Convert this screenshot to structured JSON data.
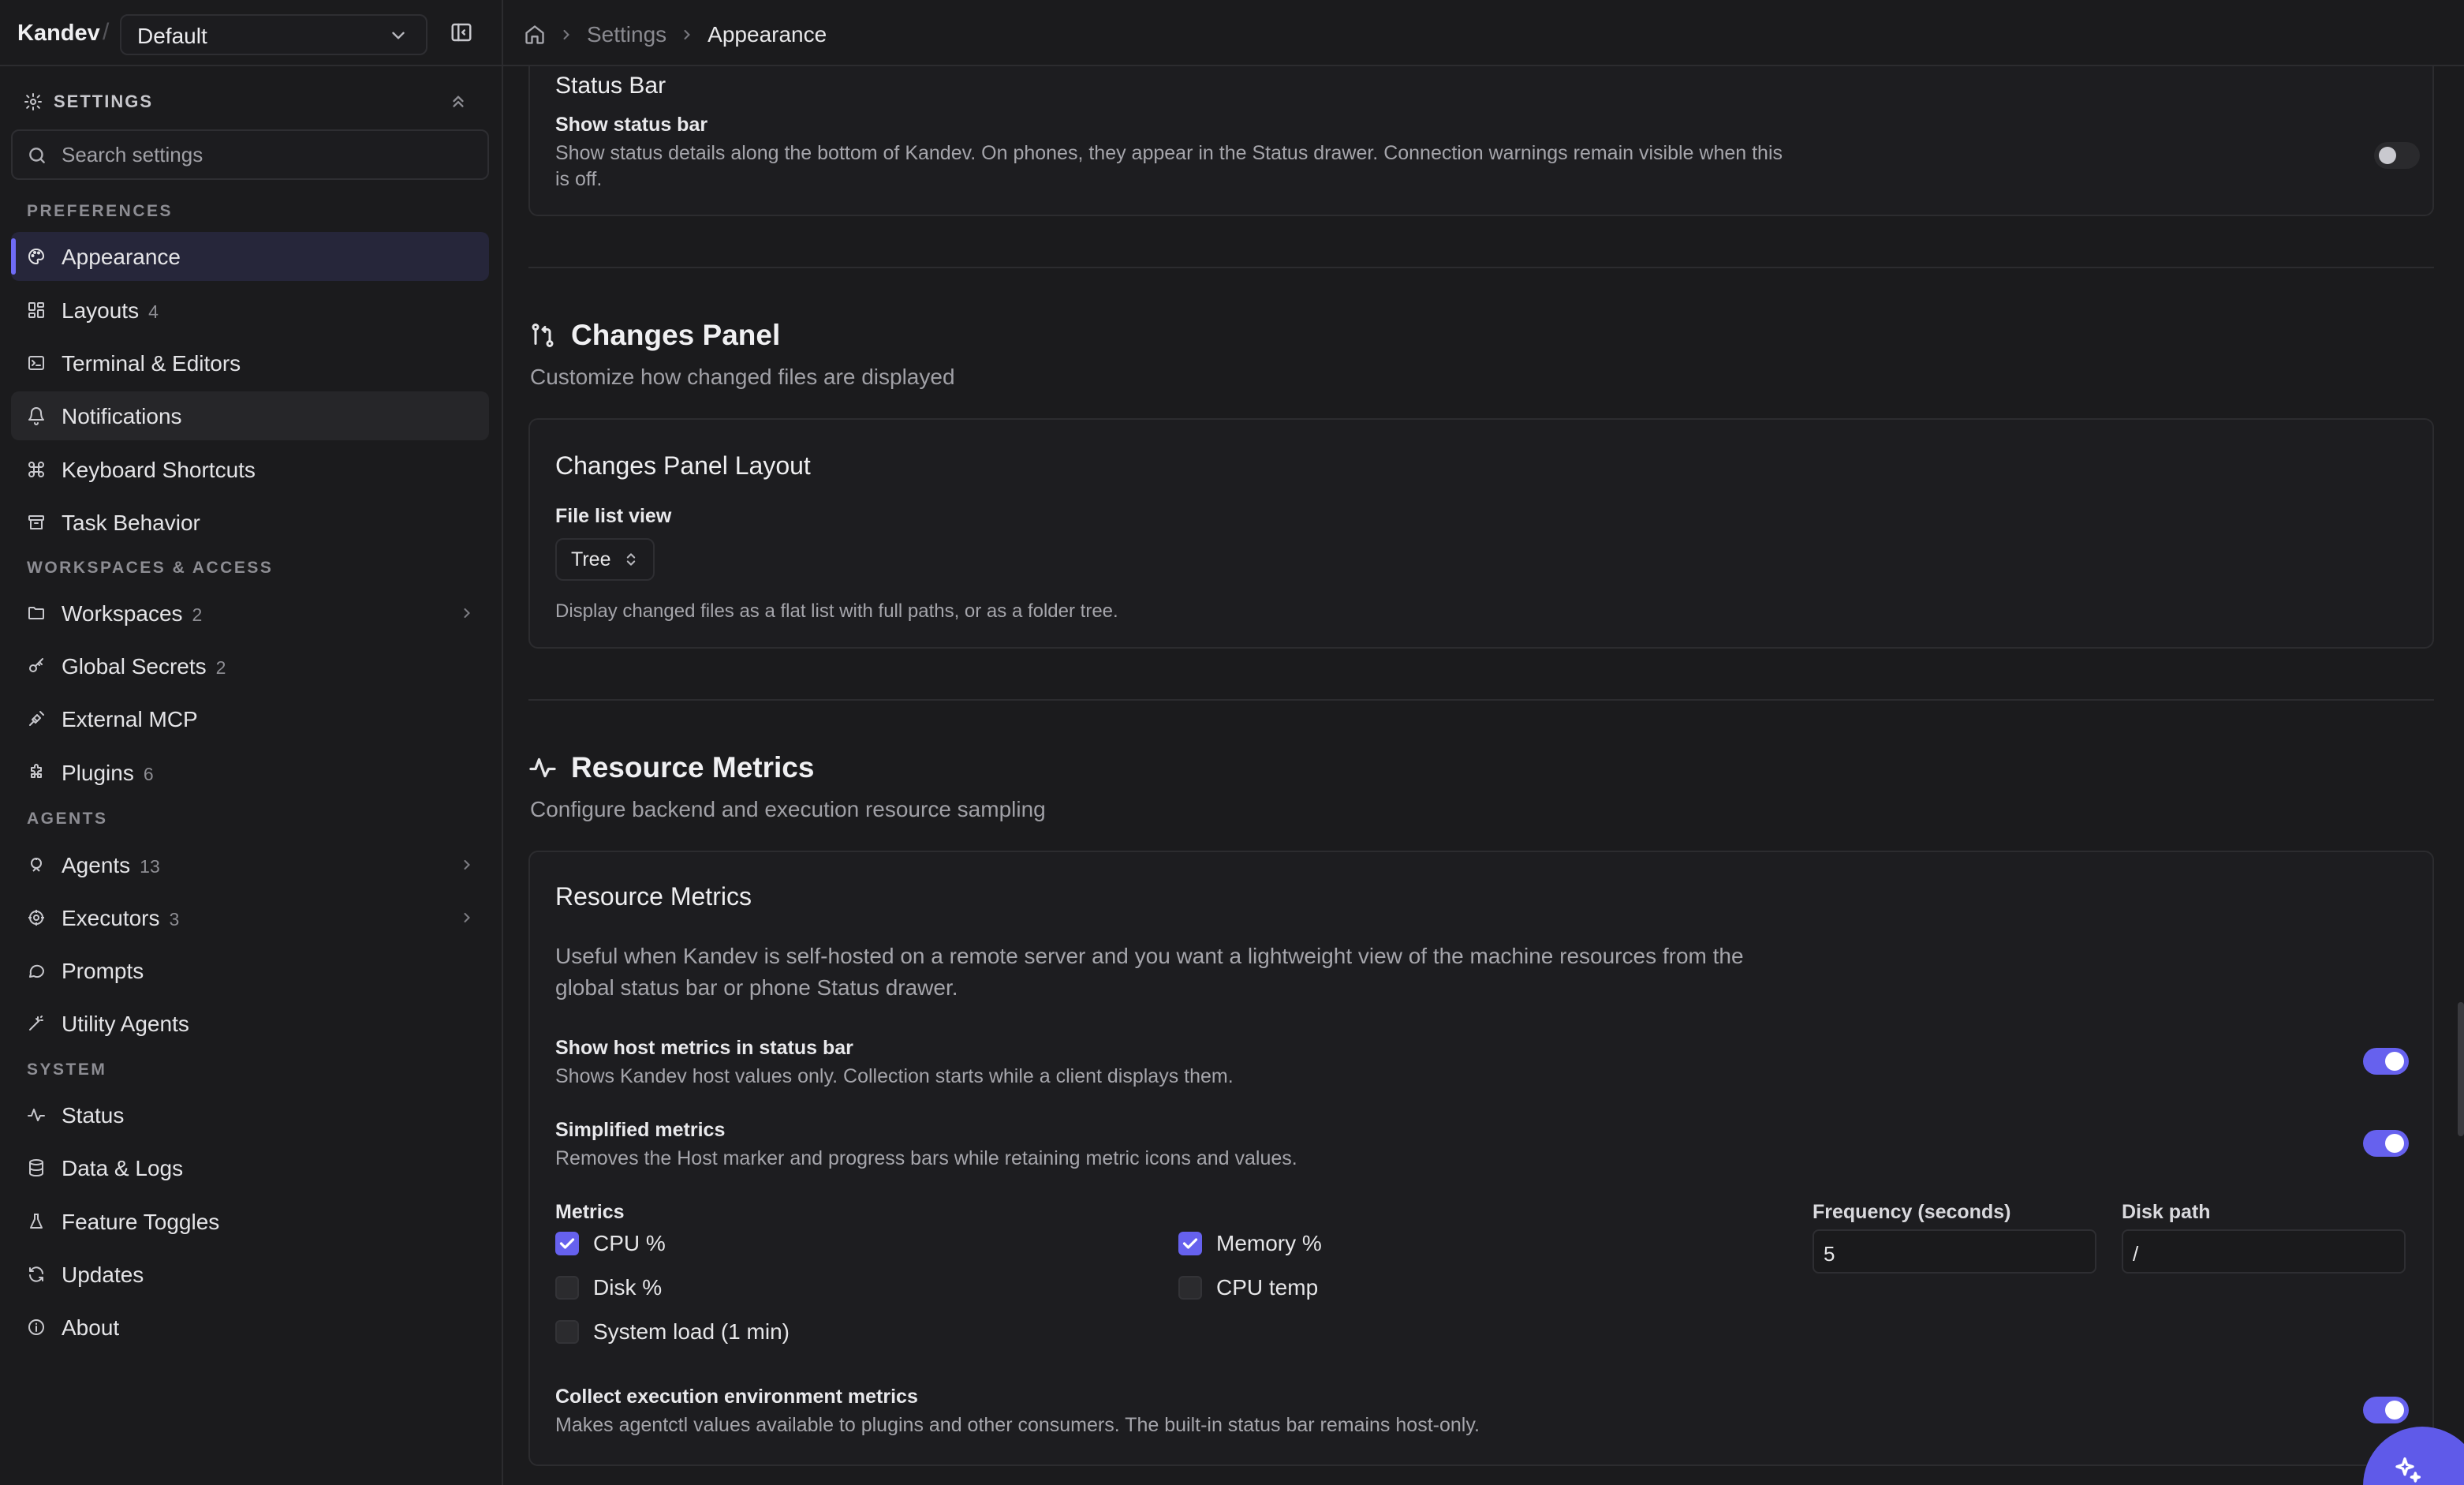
{
  "topbar": {
    "brand": "Kandev",
    "separator": "/",
    "workspace": "Default",
    "breadcrumb": {
      "settings": "Settings",
      "current": "Appearance"
    }
  },
  "sidebar": {
    "header": "SETTINGS",
    "search_placeholder": "Search settings",
    "groups": [
      {
        "label": "PREFERENCES"
      },
      {
        "label": "WORKSPACES & ACCESS"
      },
      {
        "label": "AGENTS"
      },
      {
        "label": "SYSTEM"
      }
    ],
    "items": [
      {
        "label": "Appearance",
        "count": ""
      },
      {
        "label": "Layouts",
        "count": "4"
      },
      {
        "label": "Terminal & Editors",
        "count": ""
      },
      {
        "label": "Notifications",
        "count": ""
      },
      {
        "label": "Keyboard Shortcuts",
        "count": ""
      },
      {
        "label": "Task Behavior",
        "count": ""
      },
      {
        "label": "Workspaces",
        "count": "2"
      },
      {
        "label": "Global Secrets",
        "count": "2"
      },
      {
        "label": "External MCP",
        "count": ""
      },
      {
        "label": "Plugins",
        "count": "6"
      },
      {
        "label": "Agents",
        "count": "13"
      },
      {
        "label": "Executors",
        "count": "3"
      },
      {
        "label": "Prompts",
        "count": ""
      },
      {
        "label": "Utility Agents",
        "count": ""
      },
      {
        "label": "Status",
        "count": ""
      },
      {
        "label": "Data & Logs",
        "count": ""
      },
      {
        "label": "Feature Toggles",
        "count": ""
      },
      {
        "label": "Updates",
        "count": ""
      },
      {
        "label": "About",
        "count": ""
      }
    ]
  },
  "status_bar": {
    "card_title": "Status Bar",
    "row_title": "Show status bar",
    "row_desc": "Show status details along the bottom of Kandev. On phones, they appear in the Status drawer. Connection warnings remain visible when this is off.",
    "enabled": false
  },
  "changes_panel": {
    "title": "Changes Panel",
    "subtitle": "Customize how changed files are displayed",
    "card_title": "Changes Panel Layout",
    "field_label": "File list view",
    "value": "Tree",
    "help": "Display changed files as a flat list with full paths, or as a folder tree."
  },
  "resource_metrics": {
    "title": "Resource Metrics",
    "subtitle": "Configure backend and execution resource sampling",
    "card_title": "Resource Metrics",
    "intro": "Useful when Kandev is self-hosted on a remote server and you want a lightweight view of the machine resources from the global status bar or phone Status drawer.",
    "host_metrics": {
      "title": "Show host metrics in status bar",
      "desc": "Shows Kandev host values only. Collection starts while a client displays them.",
      "enabled": true
    },
    "simplified": {
      "title": "Simplified metrics",
      "desc": "Removes the Host marker and progress bars while retaining metric icons and values.",
      "enabled": true
    },
    "metrics_label": "Metrics",
    "metrics": [
      {
        "label": "CPU %",
        "checked": true
      },
      {
        "label": "Memory %",
        "checked": true
      },
      {
        "label": "Disk %",
        "checked": false
      },
      {
        "label": "CPU temp",
        "checked": false
      },
      {
        "label": "System load (1 min)",
        "checked": false
      }
    ],
    "frequency_label": "Frequency (seconds)",
    "frequency_value": "5",
    "disk_path_label": "Disk path",
    "disk_path_value": "/",
    "exec_env": {
      "title": "Collect execution environment metrics",
      "desc": "Makes agentctl values available to plugins and other consumers. The built-in status bar remains host-only.",
      "enabled": true
    }
  },
  "colors": {
    "accent": "#6661ee",
    "background": "#1b1b1d",
    "card": "#1d1d20"
  }
}
